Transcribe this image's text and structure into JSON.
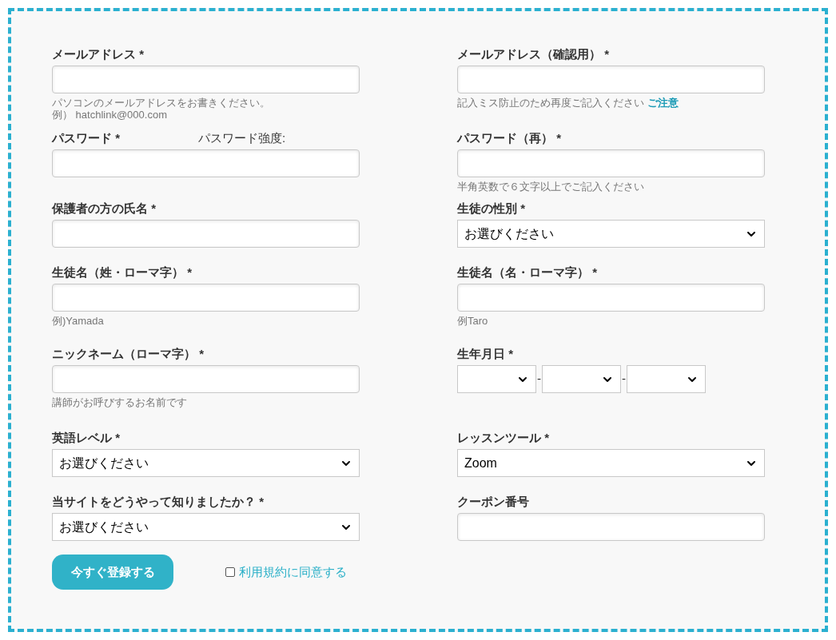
{
  "rows": [
    {
      "fields": [
        {
          "kind": "text",
          "label": "メールアドレス *",
          "hints": [
            {
              "text": "パソコンのメールアドレスをお書きください。"
            },
            {
              "text": "例） hatchlink@000.com"
            }
          ]
        },
        {
          "kind": "text",
          "label": "メールアドレス（確認用） *",
          "hints": [
            {
              "text": "記入ミス防止のため再度ご記入ください",
              "link": "ご注意"
            }
          ]
        }
      ]
    },
    {
      "fields": [
        {
          "kind": "text",
          "label": "パスワード *",
          "extra": "パスワード強度:"
        },
        {
          "kind": "text",
          "label": "パスワード（再） *",
          "hints": [
            {
              "text": "半角英数で６文字以上でご記入ください"
            }
          ]
        }
      ]
    },
    {
      "fields": [
        {
          "kind": "text",
          "label": "保護者の方の氏名 *"
        },
        {
          "kind": "select",
          "label": "生徒の性別 *",
          "value": "お選びください"
        }
      ]
    },
    {
      "fields": [
        {
          "kind": "text",
          "label": "生徒名（姓・ローマ字） *",
          "hints": [
            {
              "text": "例)Yamada"
            }
          ]
        },
        {
          "kind": "text",
          "label": "生徒名（名・ローマ字） *",
          "hints": [
            {
              "text": "例Taro"
            }
          ]
        }
      ]
    },
    {
      "fields": [
        {
          "kind": "text",
          "label": "ニックネーム（ローマ字） *",
          "hints": [
            {
              "text": "講師がお呼びするお名前です"
            }
          ]
        },
        {
          "kind": "date",
          "label": "生年月日 *",
          "separators": [
            "-",
            "-"
          ]
        }
      ]
    },
    {
      "fields": [
        {
          "kind": "select",
          "label": "英語レベル *",
          "value": "お選びください"
        },
        {
          "kind": "select",
          "label": "レッスンツール *",
          "value": "Zoom"
        }
      ]
    },
    {
      "fields": [
        {
          "kind": "select",
          "label": "当サイトをどうやって知りましたか？ *",
          "value": "お選びください"
        },
        {
          "kind": "text",
          "label": "クーポン番号"
        }
      ]
    }
  ],
  "submit": {
    "label": "今すぐ登録する"
  },
  "agree": {
    "label": "利用規約に同意する",
    "checked": false
  }
}
